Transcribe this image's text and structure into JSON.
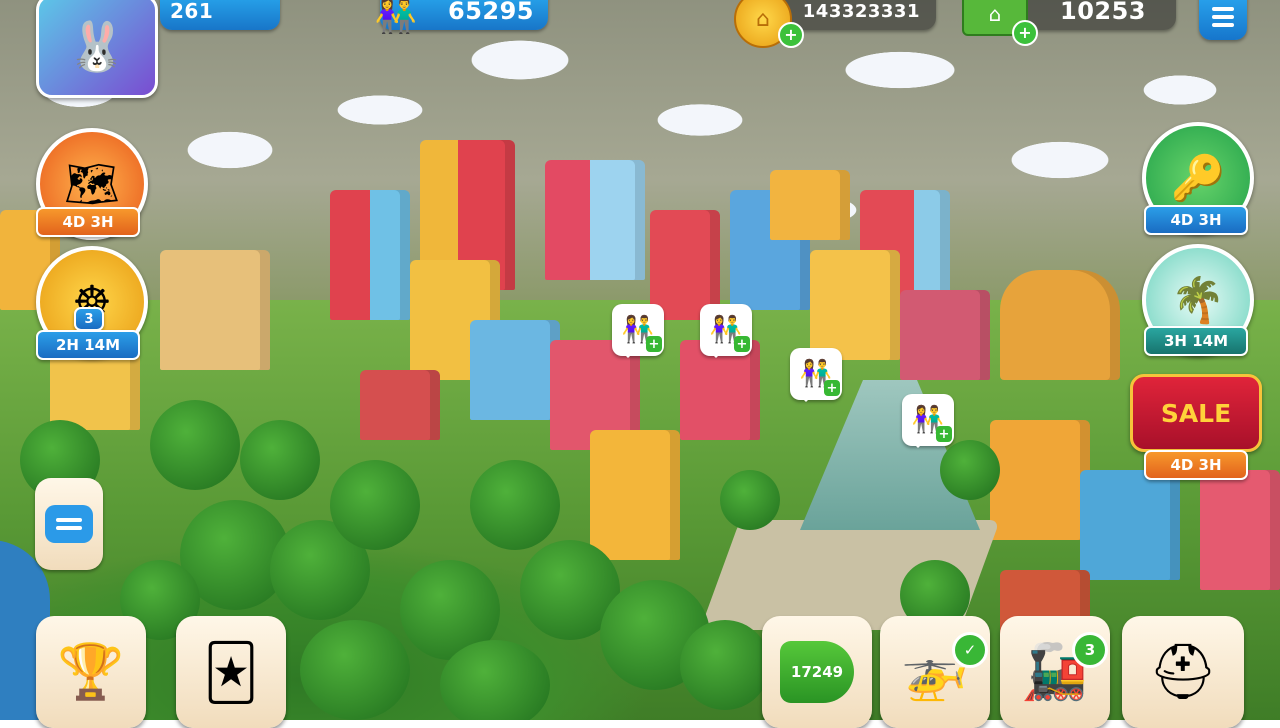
{
  "hud": {
    "level": "261",
    "population": "65295",
    "coins": "143323331",
    "cash": "10253"
  },
  "events": {
    "treasure_map_timer": "4D 3H",
    "wheel_count": "3",
    "wheel_timer": "2H 14M",
    "key_event_timer": "4D 3H",
    "calendar_timer": "3H 14M",
    "sale_label": "SALE",
    "sale_timer": "4D 3H"
  },
  "bottom": {
    "xp_value": "17249",
    "train_badge": "3"
  },
  "icons": {
    "level": "star-badge-icon",
    "population": "people-icon",
    "coins": "gold-coin-icon",
    "cash": "banknote-icon",
    "menu": "hamburger-menu-icon",
    "chat": "chat-bubble-icon",
    "trophy": "trophy-icon",
    "cards": "cards-icon",
    "helicopter": "helicopter-icon",
    "train": "train-icon",
    "build": "hard-hat-icon"
  },
  "colors": {
    "accent_blue": "#1f8fe0",
    "accent_green": "#3cc13b",
    "accent_orange": "#f07a22",
    "sale_red": "#c8162f"
  }
}
